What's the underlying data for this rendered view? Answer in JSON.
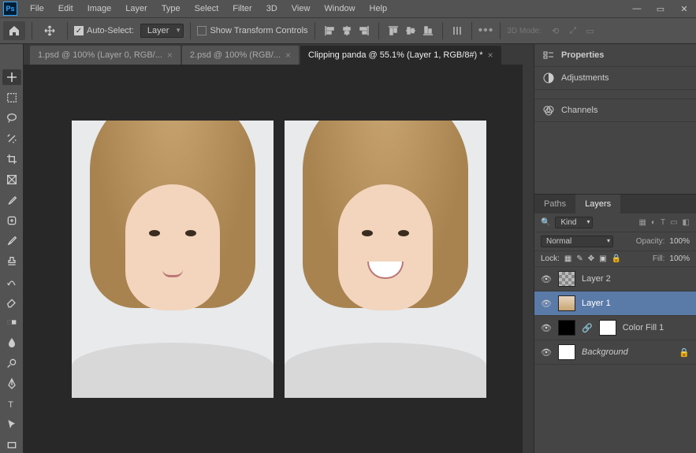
{
  "menu": {
    "file": "File",
    "edit": "Edit",
    "image": "Image",
    "layer": "Layer",
    "type": "Type",
    "select": "Select",
    "filter": "Filter",
    "threeD": "3D",
    "view": "View",
    "window": "Window",
    "help": "Help"
  },
  "options": {
    "autoSelectLabel": "Auto-Select:",
    "autoSelectTarget": "Layer",
    "showTransform": "Show Transform Controls",
    "mode3dLabel": "3D Mode:"
  },
  "tabs": [
    {
      "label": "1.psd @ 100% (Layer 0, RGB/..."
    },
    {
      "label": "2.psd @ 100% (RGB/..."
    },
    {
      "label": "Clipping panda  @ 55.1% (Layer 1, RGB/8#) *"
    }
  ],
  "panels": {
    "properties": "Properties",
    "adjustments": "Adjustments",
    "channels": "Channels",
    "pathsTab": "Paths",
    "layersTab": "Layers"
  },
  "layersPanel": {
    "kindLabel": "Kind",
    "blendMode": "Normal",
    "opacityLabel": "Opacity:",
    "opacityValue": "100%",
    "lockLabel": "Lock:",
    "fillLabel": "Fill:",
    "fillValue": "100%",
    "layers": [
      {
        "name": "Layer 2"
      },
      {
        "name": "Layer 1"
      },
      {
        "name": "Color Fill 1"
      },
      {
        "name": "Background"
      }
    ]
  }
}
